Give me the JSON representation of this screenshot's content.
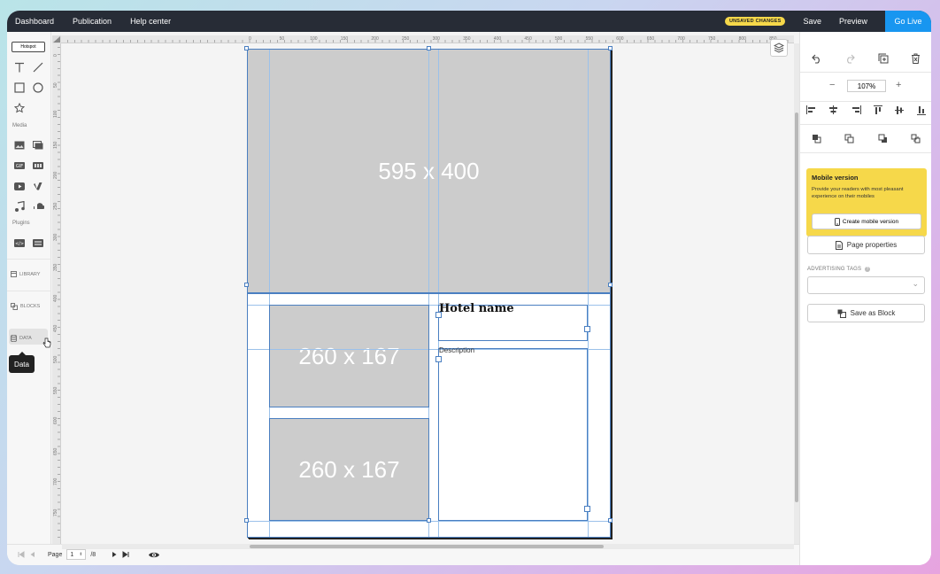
{
  "topbar": {
    "nav": [
      "Dashboard",
      "Publication",
      "Help center"
    ],
    "unsaved_badge": "UNSAVED CHANGES",
    "save_label": "Save",
    "preview_label": "Preview",
    "golive_label": "Go Live"
  },
  "left_toolbar": {
    "hotspot_label": "Hotspot",
    "media_label": "Media",
    "plugins_label": "Plugins",
    "library_label": "LIBRARY",
    "blocks_label": "BLOCKS",
    "data_label": "DATA",
    "tooltip": "Data"
  },
  "rulers": {
    "top_ticks": [
      "0",
      "50",
      "100",
      "150",
      "200",
      "250",
      "300",
      "350",
      "400",
      "450",
      "500",
      "550",
      "600",
      "650",
      "700",
      "750",
      "800",
      "850"
    ],
    "left_ticks": [
      "0",
      "50",
      "100",
      "150",
      "200",
      "250",
      "300",
      "350",
      "400",
      "450",
      "500",
      "550",
      "600",
      "650",
      "700",
      "750"
    ]
  },
  "canvas": {
    "big_placeholder": "595 x 400",
    "small_placeholder_1": "260 x 167",
    "small_placeholder_2": "260 x 167",
    "hotel_name": "Hotel name",
    "description": "Description"
  },
  "pager": {
    "page_label": "Page",
    "current_page": "1",
    "total_pages": "/8"
  },
  "right_panel": {
    "zoom": "107%",
    "mobile_title": "Mobile version",
    "mobile_desc": "Provide your readers with most pleasant experience on their mobiles",
    "mobile_button": "Create mobile version",
    "page_properties": "Page properties",
    "adv_tags_label": "ADVERTISING TAGS",
    "save_block": "Save as Block"
  }
}
